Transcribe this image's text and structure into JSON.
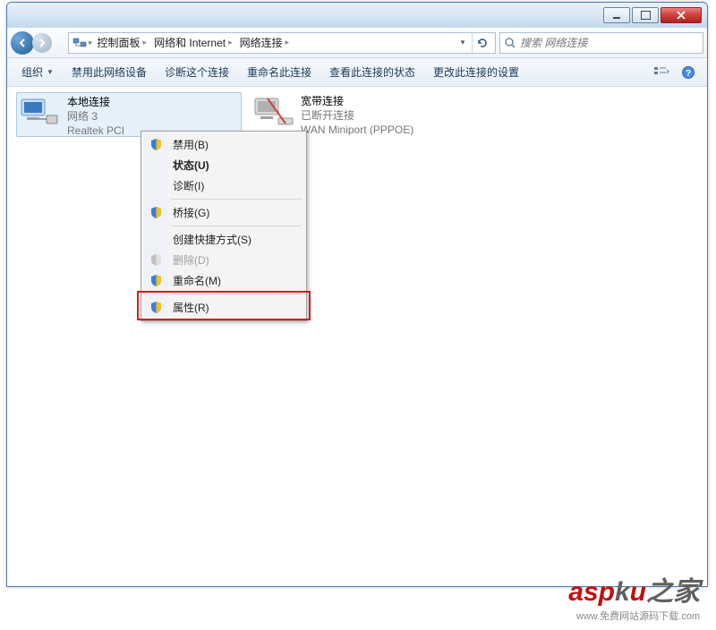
{
  "titlebar": {
    "min": "minimize",
    "max": "maximize",
    "close": "close"
  },
  "breadcrumbs": {
    "item0": "控制面板",
    "item1": "网络和 Internet",
    "item2": "网络连接"
  },
  "search": {
    "placeholder": "搜索 网络连接"
  },
  "toolbar": {
    "organize": "组织",
    "disable": "禁用此网络设备",
    "diagnose": "诊断这个连接",
    "rename": "重命名此连接",
    "status": "查看此连接的状态",
    "settings": "更改此连接的设置"
  },
  "connections": {
    "item0": {
      "title": "本地连接",
      "line2": "网络  3",
      "line3": "Realtek PCI"
    },
    "item1": {
      "title": "宽带连接",
      "line2": "已断开连接",
      "line3": "WAN Miniport (PPPOE)"
    }
  },
  "context_menu": {
    "disable": "禁用(B)",
    "status": "状态(U)",
    "diagnose": "诊断(I)",
    "bridge": "桥接(G)",
    "shortcut": "创建快捷方式(S)",
    "delete": "删除(D)",
    "rename": "重命名(M)",
    "properties": "属性(R)"
  },
  "watermark": {
    "logo1": "asp",
    "logo2": "k",
    "logo3": "u",
    "logo4": "之家",
    "tag": "www.免费网站源码下载.com"
  }
}
